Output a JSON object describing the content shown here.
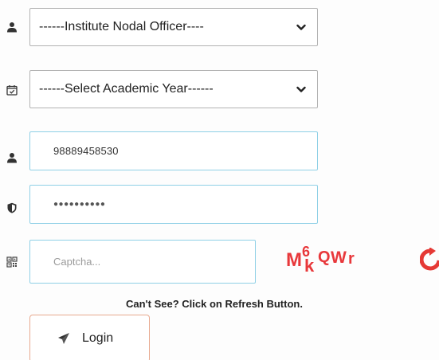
{
  "role_select": {
    "selected": "------Institute Nodal Officer----",
    "icon": "user-icon"
  },
  "year_select": {
    "selected": "------Select Academic Year------",
    "icon": "calendar-check-icon"
  },
  "username": {
    "value": "98889458530",
    "icon": "user-icon"
  },
  "password": {
    "masked_value": "●●●●●●●●●●",
    "icon": "shield-icon"
  },
  "captcha": {
    "placeholder": "Captcha...",
    "icon": "qrcode-icon",
    "image_text": "M6kQWr",
    "image_color": "#e8383b"
  },
  "hint_text": "Can't See? Click on Refresh Button.",
  "login": {
    "label": "Login",
    "icon": "paper-plane-icon",
    "border_color": "#e8a98f"
  },
  "colors": {
    "input_border": "#8fd0e6",
    "select_border": "#b3b3b3",
    "refresh_icon": "#e53935"
  }
}
